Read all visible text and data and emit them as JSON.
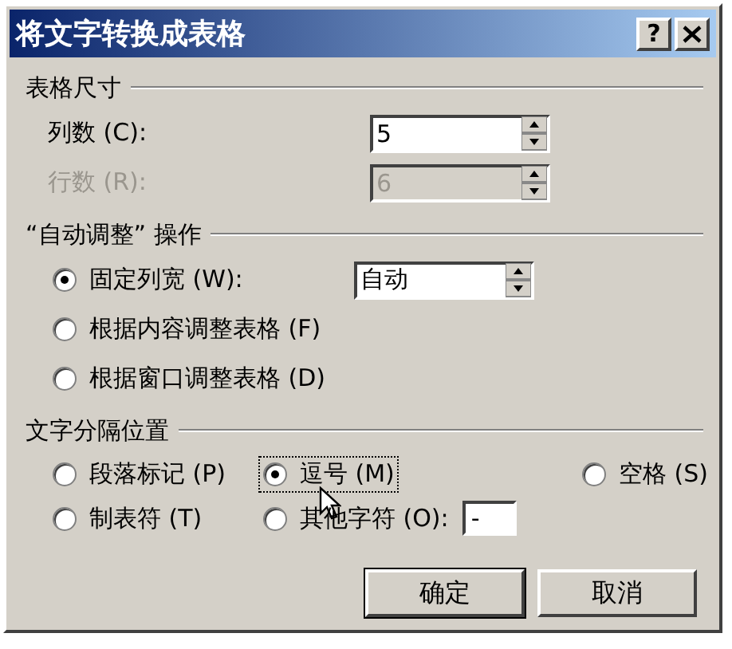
{
  "window": {
    "title": "将文字转换成表格",
    "help_button": "?"
  },
  "table_size": {
    "title": "表格尺寸",
    "fields": [
      {
        "label": "列数 (C):",
        "value": "5",
        "disabled": false
      },
      {
        "label": "行数 (R):",
        "value": "6",
        "disabled": true
      }
    ]
  },
  "autofit": {
    "title": "“自动调整” 操作",
    "options": [
      {
        "label": "固定列宽 (W):",
        "selected": true,
        "kind": "spinner",
        "value": "自动"
      },
      {
        "label": "根据内容调整表格 (F)",
        "selected": false,
        "kind": "plain"
      },
      {
        "label": "根据窗口调整表格 (D)",
        "selected": false,
        "kind": "plain"
      }
    ]
  },
  "separator": {
    "title": "文字分隔位置",
    "options": [
      {
        "label": "段落标记 (P)",
        "selected": false,
        "focused": false,
        "kind": "plain"
      },
      {
        "label": "逗号 (M)",
        "selected": true,
        "focused": true,
        "kind": "plain"
      },
      {
        "label": "空格 (S)",
        "selected": false,
        "focused": false,
        "kind": "plain"
      },
      {
        "label": "制表符 (T)",
        "selected": false,
        "focused": false,
        "kind": "plain"
      },
      {
        "label": "其他字符 (O):",
        "selected": false,
        "focused": false,
        "kind": "field",
        "value": "-"
      }
    ]
  },
  "buttons": [
    {
      "label": "确定",
      "default": true
    },
    {
      "label": "取消",
      "default": false
    }
  ]
}
